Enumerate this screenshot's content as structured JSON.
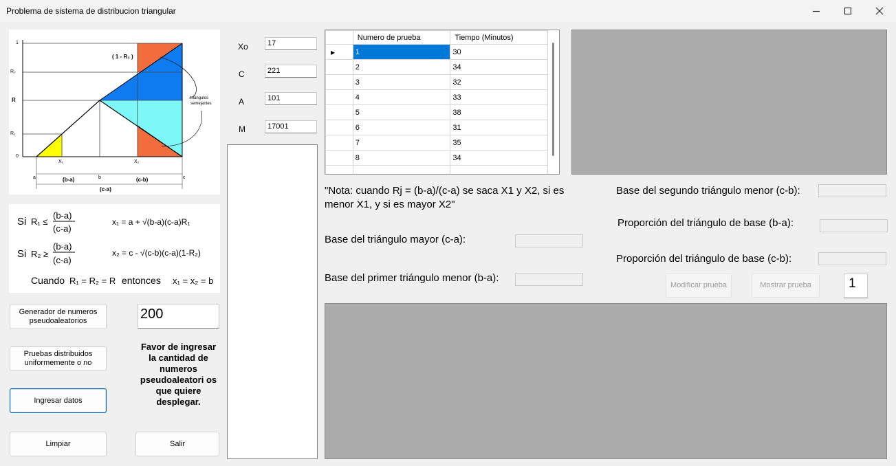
{
  "window": {
    "title": "Problema de sistema de distribucion triangular"
  },
  "diagram": {
    "y_labels": [
      "1",
      "R₂",
      "R",
      "R₁",
      "0"
    ],
    "top_label": "( 1 - R₂ )",
    "side_label_1": "triángulos",
    "side_label_2": "semejantes",
    "x_marks": [
      "X₁",
      "X₂"
    ],
    "ticks": [
      "a",
      "b",
      "c"
    ],
    "spans": [
      "(b-a)",
      "(c-b)",
      "(c-a)"
    ]
  },
  "formulas": {
    "si": "Si",
    "r1": "R₁ ≤",
    "r2": "R₂ ≥",
    "frac_num1": "(b-a)",
    "frac_num2": "(b-a)",
    "frac_den": "(c-a)",
    "x1": "x₁ = a + √(b-a)(c-a)R₁",
    "x2": "x₂ = c - √(c-b)(c-a)(1-R₂)",
    "cuando": "Cuando",
    "cuando_eq": "R₁ = R₂ = R",
    "entonces": "entonces",
    "entonces_eq": "x₁ = x₂ = b"
  },
  "left_buttons": {
    "generador": "Generador de numeros pseudoaleatorios",
    "pruebas": "Pruebas distribuidos uniformemente o no",
    "ingresar": "Ingresar datos",
    "limpiar": "Limpiar",
    "salir": "Salir"
  },
  "quantity": {
    "value": "200"
  },
  "instruction": "Favor de ingresar la cantidad de numeros pseudoaleatori os que quiere desplegar.",
  "params": [
    {
      "label": "Xo",
      "value": "17"
    },
    {
      "label": "C",
      "value": "221"
    },
    {
      "label": "A",
      "value": "101"
    },
    {
      "label": "M",
      "value": "17001"
    }
  ],
  "grid": {
    "headers": [
      "Numero de prueba",
      "Tiempo (Minutos)"
    ],
    "rows": [
      [
        "1",
        "30"
      ],
      [
        "2",
        "34"
      ],
      [
        "3",
        "32"
      ],
      [
        "4",
        "33"
      ],
      [
        "5",
        "38"
      ],
      [
        "6",
        "31"
      ],
      [
        "7",
        "35"
      ],
      [
        "8",
        "34"
      ]
    ]
  },
  "note": "\"Nota: cuando Rj = (b-a)/(c-a) se saca X1 y X2, si es menor X1, y si es mayor X2\"",
  "fields": {
    "base_mayor": "Base del triángulo mayor (c-a):",
    "base_primer": "Base del primer triángulo menor (b-a):",
    "base_segundo": "Base del segundo triángulo menor (c-b):",
    "prop_ba": "Proporción del triángulo de base (b-a):",
    "prop_cb": "Proporción del triángulo de base (c-b):"
  },
  "actions": {
    "modificar": "Modificar prueba",
    "mostrar": "Mostrar prueba",
    "counter": "1"
  },
  "colors": {
    "selection": "#0078d7",
    "placeholder_gray": "#ababab",
    "orange": "#f26d3d",
    "blue": "#0f7bf0",
    "cyan": "#7df7f7",
    "yellow": "#ffff00"
  }
}
